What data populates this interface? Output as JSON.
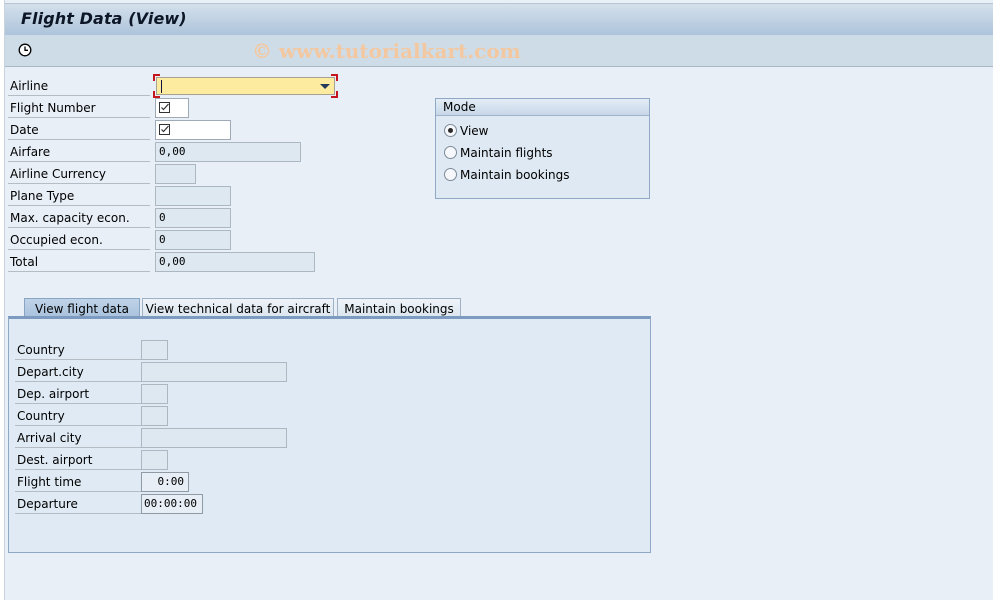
{
  "window": {
    "title": "Flight Data (View)"
  },
  "toolbar": {
    "history_icon": "clock-icon",
    "watermark": "© www.tutorialkart.com"
  },
  "header_fields": [
    {
      "label": "Airline",
      "value": "",
      "kind": "dropdown",
      "required": true
    },
    {
      "label": "Flight Number",
      "value": "",
      "kind": "checkbox-input"
    },
    {
      "label": "Date",
      "value": "",
      "kind": "checkbox-input"
    },
    {
      "label": "Airfare",
      "value": "0,00"
    },
    {
      "label": "Airline Currency",
      "value": ""
    },
    {
      "label": "Plane Type",
      "value": ""
    },
    {
      "label": "Max. capacity econ.",
      "value": "0"
    },
    {
      "label": "Occupied econ.",
      "value": "0"
    },
    {
      "label": "Total",
      "value": "0,00"
    }
  ],
  "mode": {
    "title": "Mode",
    "options": [
      {
        "label": "View",
        "selected": true
      },
      {
        "label": "Maintain flights",
        "selected": false
      },
      {
        "label": "Maintain bookings",
        "selected": false
      }
    ]
  },
  "tabs": [
    {
      "label": "View flight data",
      "active": true
    },
    {
      "label": "View technical data for aircraft",
      "active": false
    },
    {
      "label": "Maintain bookings",
      "active": false
    }
  ],
  "flight_fields": [
    {
      "label": "Country",
      "value": ""
    },
    {
      "label": "Depart.city",
      "value": ""
    },
    {
      "label": "Dep. airport",
      "value": ""
    },
    {
      "label": "Country",
      "value": ""
    },
    {
      "label": "Arrival city",
      "value": ""
    },
    {
      "label": "Dest. airport",
      "value": ""
    },
    {
      "label": "Flight time",
      "value": "0:00"
    },
    {
      "label": "Departure",
      "value": "00:00:00"
    }
  ]
}
